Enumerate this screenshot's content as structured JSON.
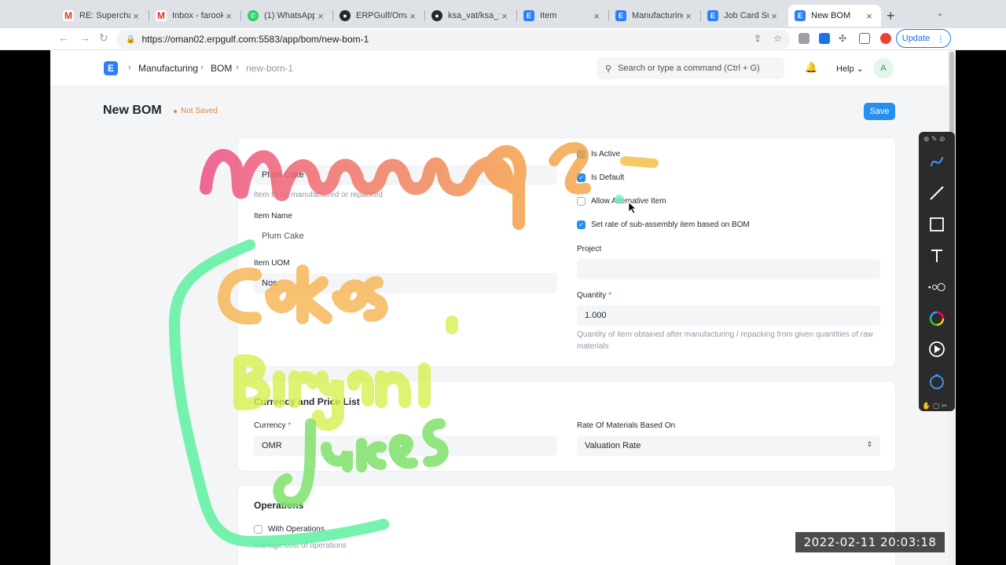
{
  "browser": {
    "tabs": [
      {
        "title": "RE: Superchar",
        "icon": "gmail-icon"
      },
      {
        "title": "Inbox - farook",
        "icon": "gmail-icon"
      },
      {
        "title": "(1) WhatsApp",
        "icon": "whatsapp-icon"
      },
      {
        "title": "ERPGulf/Omar",
        "icon": "github-icon"
      },
      {
        "title": "ksa_vat/ksa_v",
        "icon": "github-icon"
      },
      {
        "title": "Item",
        "icon": "erpnext-icon"
      },
      {
        "title": "Manufacturing",
        "icon": "erpnext-icon"
      },
      {
        "title": "Job Card Sum",
        "icon": "erpnext-icon"
      },
      {
        "title": "New BOM",
        "icon": "erpnext-icon"
      }
    ],
    "url": "https://oman02.erpgulf.com:5583/app/bom/new-bom-1",
    "update_label": "Update"
  },
  "app": {
    "logo_letter": "E",
    "breadcrumbs": [
      "Manufacturing",
      "BOM",
      "new-bom-1"
    ],
    "search_placeholder": "Search or type a command (Ctrl + G)",
    "help_label": "Help",
    "avatar_letter": "A"
  },
  "form": {
    "title": "New BOM",
    "status": "Not Saved",
    "save_label": "Save",
    "item_value": "Plum Cake",
    "item_help": "Item to be manufactured or repacked",
    "item_name_label": "Item Name",
    "item_name_value": "Plum Cake",
    "item_uom_label": "Item UOM",
    "item_uom_value": "Nos",
    "is_active_label": "Is Active",
    "is_default_label": "Is Default",
    "allow_alternative_label": "Allow Alternative Item",
    "set_rate_label": "Set rate of sub-assembly item based on BOM",
    "project_label": "Project",
    "quantity_label": "Quantity",
    "quantity_value": "1.000",
    "quantity_help": "Quantity of item obtained after manufacturing / repacking from given quantities of raw materials",
    "currency_section": "Currency and Price List",
    "currency_label": "Currency",
    "currency_value": "OMR",
    "rate_based_label": "Rate Of Materials Based On",
    "rate_based_value": "Valuation Rate",
    "operations_section": "Operations",
    "with_operations_label": "With Operations",
    "operations_help": "Manage cost of operations"
  },
  "overlay": {
    "timestamp": "2022-02-11  20:03:18"
  },
  "colors": {
    "primary": "#2490ef",
    "brand": "#2d7ff9",
    "warning": "#e0853d"
  }
}
